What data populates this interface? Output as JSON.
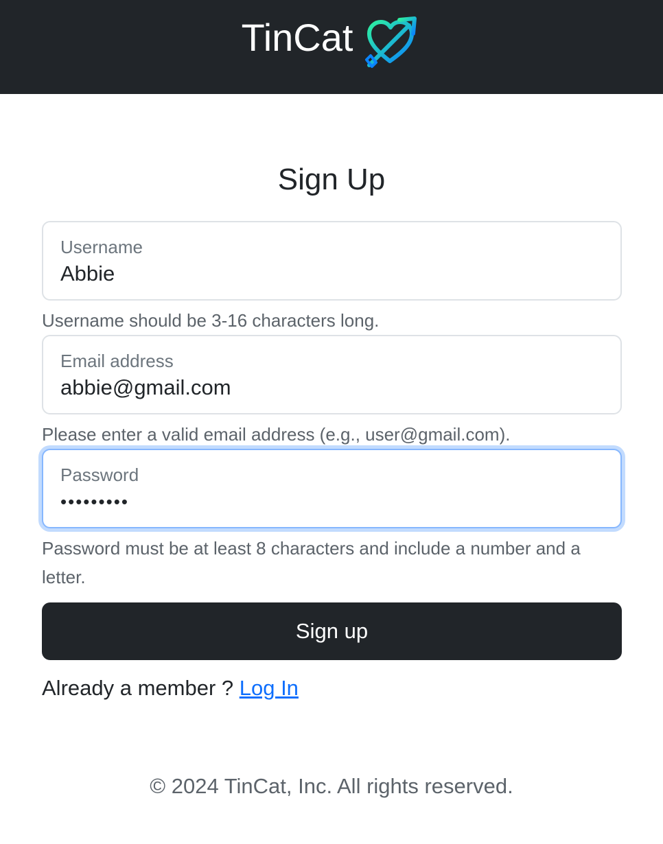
{
  "navbar": {
    "brand": "TinCat",
    "logo_icon": "heart-arrow-icon",
    "logo_colors": [
      "#1ee6a1",
      "#0a84ff"
    ]
  },
  "page": {
    "title": "Sign Up"
  },
  "form": {
    "username": {
      "label": "Username",
      "value": "Abbie",
      "help": "Username should be 3-16 characters long."
    },
    "email": {
      "label": "Email address",
      "value": "abbie@gmail.com",
      "help": "Please enter a valid email address (e.g., user@gmail.com)."
    },
    "password": {
      "label": "Password",
      "value": "password1",
      "help": "Password must be at least 8 characters and include a number and a letter."
    },
    "submit_label": "Sign up"
  },
  "member": {
    "text": "Already a member ? ",
    "link": "Log In"
  },
  "footer": {
    "text": "© 2024 TinCat, Inc. All rights reserved."
  },
  "colors": {
    "navbar_bg": "#212529",
    "link": "#0d6efd",
    "focus_ring": "#86b7fe"
  }
}
